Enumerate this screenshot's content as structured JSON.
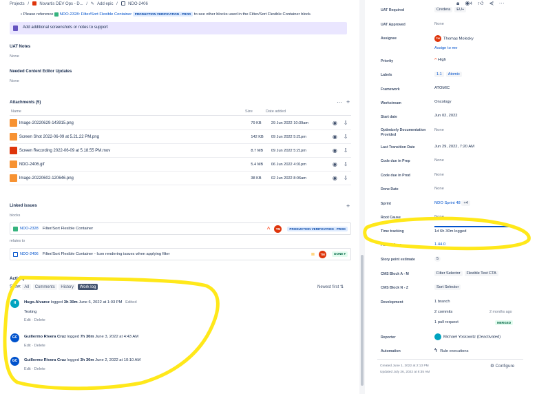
{
  "breadcrumb": {
    "projects": "Projects",
    "sep": "/",
    "project": "Novartis DEV Ops - D...",
    "add_epic": "Add epic",
    "issue_key": "NDO-2406"
  },
  "description": {
    "reference_prefix": "Please reference",
    "reference_link": "NDO-2328: Filter/Sort Flexible Container",
    "reference_status": "PRODUCTION VERIFICATION - PROD",
    "reference_suffix": "to see other blocks used in the Filter/Sort Flexible Container block.",
    "note_panel": "Add additional screenshots or notes to support"
  },
  "uat_notes": {
    "label": "UAT Notes",
    "value": "None"
  },
  "content_editor": {
    "label": "Needed Content Editor Updates",
    "value": "None"
  },
  "attachments": {
    "title": "Attachments (5)",
    "more": "···",
    "add": "+",
    "col_name": "Name",
    "col_size": "Size",
    "col_date": "Date added",
    "rows": [
      {
        "name": "Image-20220629-143915.png",
        "size": "79 KB",
        "date": "29 Jun 2022 10:39am",
        "color": "#f79232"
      },
      {
        "name": "Screen Shot 2022-06-09 at 5.21.22 PM.png",
        "size": "142 KB",
        "date": "09 Jun 2022 5:21pm",
        "color": "#f79232"
      },
      {
        "name": "Screen Recording 2022-06-09 at 5.18.55 PM.mov",
        "size": "8.7 MB",
        "date": "09 Jun 2022 5:21pm",
        "color": "#de350b"
      },
      {
        "name": "NDO-2406.gif",
        "size": "5.4 MB",
        "date": "06 Jun 2022 4:01pm",
        "color": "#f79232"
      },
      {
        "name": "Image-20220602-120646.png",
        "size": "38 KB",
        "date": "02 Jun 2022 8:06am",
        "color": "#f79232"
      }
    ]
  },
  "linked_issues": {
    "title": "Linked issues",
    "add": "+",
    "blocks_label": "blocks",
    "relates_label": "relates to",
    "issues": [
      {
        "key": "NDO-2328",
        "summary": "Filter/Sort Flexible Container",
        "priority": "^",
        "avatar": "TM",
        "status": "PRODUCTION VERIFICATION - PROD"
      },
      {
        "key": "NDO-2406",
        "summary": "Filter/Sort Flexible Container - Icon rendering issues when applying filter",
        "priority": "=",
        "avatar": "TM",
        "status": "DONE"
      }
    ]
  },
  "activity": {
    "title": "Activity",
    "show_label": "Show:",
    "tabs": [
      "All",
      "Comments",
      "History",
      "Work log"
    ],
    "active_tab": "Work log",
    "sort": "Newest first",
    "entries": [
      {
        "avatar": "H",
        "avatar_color": "#00a3bf",
        "author": "Hugo.Alvarez",
        "action": "logged",
        "time": "3h 30m",
        "date": "June 6, 2022 at 1:03 PM",
        "edited": "Edited",
        "body": "Testing",
        "edit": "Edit",
        "delete": "Delete"
      },
      {
        "avatar": "GC",
        "avatar_color": "#0052cc",
        "author": "Guillermo Rivera Cruz",
        "action": "logged",
        "time": "7h 30m",
        "date": "June 3, 2022 at 4:43 AM",
        "edited": "",
        "body": "",
        "edit": "Edit",
        "delete": "Delete"
      },
      {
        "avatar": "GC",
        "avatar_color": "#0052cc",
        "author": "Guillermo Rivera Cruz",
        "action": "logged",
        "time": "3h 30m",
        "date": "June 2, 2022 at 10:10 AM",
        "edited": "",
        "body": "",
        "edit": "Edit",
        "delete": "Delete"
      }
    ]
  },
  "top_icons": {
    "watch_count": "4"
  },
  "details": {
    "uat_required": {
      "label": "UAT Required",
      "value": "Credera",
      "value2": "EU+"
    },
    "uat_approved": {
      "label": "UAT Approved",
      "value": "None"
    },
    "assignee": {
      "label": "Assignee",
      "value": "Thomas Molesky",
      "avatar": "TM",
      "assign_me": "Assign to me"
    },
    "priority": {
      "label": "Priority",
      "value": "High"
    },
    "labels": {
      "label": "Labels",
      "value1": "1.1",
      "value2": "Atomic"
    },
    "framework": {
      "label": "Framework",
      "value": "ATOMIC"
    },
    "workstream": {
      "label": "Workstream",
      "value": "Oncology"
    },
    "start_date": {
      "label": "Start date",
      "value": "Jun 02, 2022"
    },
    "optimizely": {
      "label": "Optimizely Documentation Provided",
      "value": "None"
    },
    "last_transition": {
      "label": "Last Transition Date",
      "value": "Jun 29, 2022, 7:20 AM"
    },
    "code_prep": {
      "label": "Code due in Prep",
      "value": "None"
    },
    "code_prod": {
      "label": "Code due in Prod",
      "value": "None"
    },
    "done_date": {
      "label": "Done Date",
      "value": "None"
    },
    "sprint": {
      "label": "Sprint",
      "value": "NDO Sprint 48",
      "extra": "+4"
    },
    "root_cause": {
      "label": "Root Cause",
      "value": "None"
    },
    "time_tracking": {
      "label": "Time tracking",
      "value": "1d 6h 30m logged",
      "progress": 1.0
    },
    "fix_versions": {
      "label": "Fix versions",
      "value": "1.44.0"
    },
    "story_points": {
      "label": "Story point estimate",
      "value": "5"
    },
    "cms_a_m": {
      "label": "CMS Block A - M",
      "value1": "Filter Selector",
      "value2": "Flexible Test CTA"
    },
    "cms_n_z": {
      "label": "CMS Block N - Z",
      "value": "Sort Selector"
    },
    "development": {
      "label": "Development",
      "branch": "1 branch",
      "commits": "2 commits",
      "commits_time": "2 months ago",
      "pr": "1 pull request",
      "pr_status": "MERGED"
    },
    "reporter": {
      "label": "Reporter",
      "value": "Michael Yoskowitz (Deactivated)"
    },
    "automation": {
      "label": "Automation",
      "value": "Rule executions"
    }
  },
  "footer": {
    "created": "Created June 1, 2022 at 2:13 PM",
    "updated": "Updated July 26, 2022 at 8:35 AM",
    "configure": "Configure"
  },
  "colors": {
    "highlight": "#ffe81a",
    "link": "#0052cc",
    "text": "#172b4d"
  }
}
